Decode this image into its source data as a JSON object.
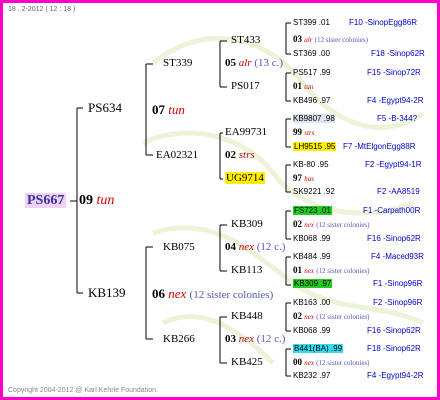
{
  "header": "18 . 2-2012 ( 12 : 18 )",
  "footer": "Copyright 2004-2012 @ Karl Kehrle Foundation.",
  "colors": {
    "frame": "#ff00cc",
    "source": "#0000cc",
    "mark": "#cc0000",
    "sister": "#5555bb"
  },
  "root": {
    "id": "PS667",
    "num": "09",
    "mark": "tun"
  },
  "g2": [
    {
      "id": "PS634",
      "num": "07",
      "mark": "tun"
    },
    {
      "id": "KB139",
      "num": "06",
      "mark": "nex",
      "note": "(12 sister colonies)"
    }
  ],
  "g3": [
    {
      "id": "ST339",
      "num": "05",
      "mark": "alr",
      "note": "(13 c.)"
    },
    {
      "id": "EA02321",
      "num": "02",
      "mark": "strs"
    },
    {
      "id": "KB075",
      "num": "04",
      "mark": "nex",
      "note": "(12 c.)"
    },
    {
      "id": "KB266",
      "num": "03",
      "mark": "nex",
      "note": "(12 c.)"
    }
  ],
  "g4": [
    "ST433",
    "PS017",
    "EA99731",
    "UG9714",
    "KB309",
    "KB113",
    "KB448",
    "KB425"
  ],
  "g5": [
    {
      "top": "ST399 .01",
      "topsrc": "F10 -SinopEgg86R",
      "num": "03",
      "mark": "alr",
      "note": "(12 sister colonies)",
      "bot": "ST369 .00",
      "botsrc": "F18 -Sinop62R"
    },
    {
      "top": "PS517 .99",
      "topsrc": "F15 -Sinop72R",
      "num": "01",
      "mark": "tun",
      "note": "",
      "bot": "KB496 .97",
      "botsrc": "F4 -Egypt94-2R"
    },
    {
      "top": "KB9807 .98",
      "topsrc": "F5 -B-344?",
      "num": "99",
      "mark": "strs",
      "note": "",
      "bot": "LH9515 .95",
      "botsrc": "F7 -MtElgonEgg88R"
    },
    {
      "top": "KB-80 .95",
      "topsrc": "F2 -Egypt94-1R",
      "num": "97",
      "mark": "has",
      "note": "",
      "bot": "SK9221 .92",
      "botsrc": "F2 -AA8519"
    },
    {
      "top": "FS723 .01",
      "topsrc": "F1 -Carpath00R",
      "num": "02",
      "mark": "nex",
      "note": "(12 sister colonies)",
      "bot": "KB068 .99",
      "botsrc": "F16 -Sinop62R"
    },
    {
      "top": "KB484 .99",
      "topsrc": "F4 -Maced93R",
      "num": "01",
      "mark": "nex",
      "note": "(12 sister colonies)",
      "bot": "KB309 .97",
      "botsrc": "F1 -Sinop96R"
    },
    {
      "top": "KB163 .00",
      "topsrc": "F2 -Sinop96R",
      "num": "02",
      "mark": "nex",
      "note": "(12 sister colonies)",
      "bot": "KB068 .99",
      "botsrc": "F16 -Sinop62R"
    },
    {
      "top": "B441(BA) .99",
      "topsrc": "F18 -Sinop62R",
      "num": "00",
      "mark": "nex",
      "note": "(12 sister colonies)",
      "bot": "KB232 .97",
      "botsrc": "F4 -Egypt94-2R"
    }
  ]
}
